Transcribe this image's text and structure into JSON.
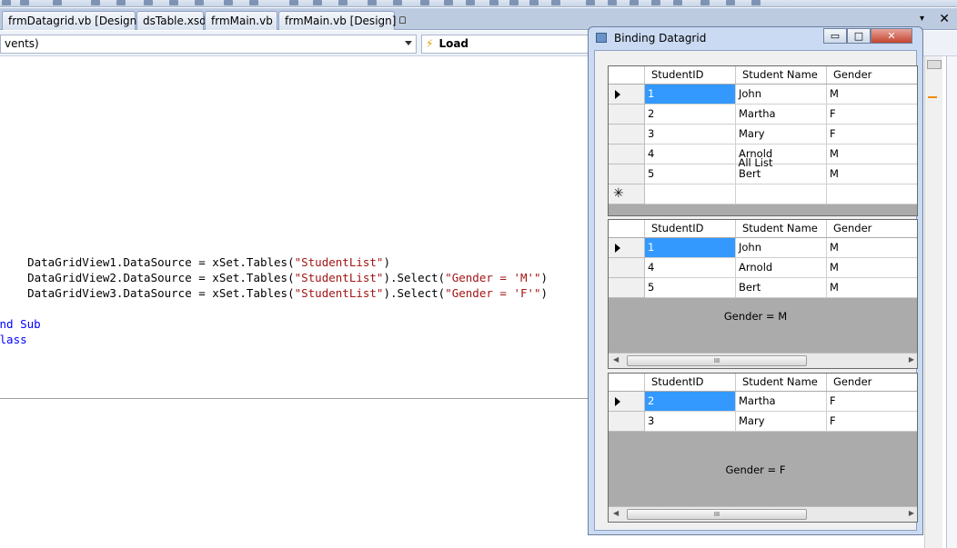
{
  "tabs": [
    {
      "label": "frmDatagrid.vb [Design]",
      "locked": true
    },
    {
      "label": "dsTable.xsd",
      "locked": false
    },
    {
      "label": "frmMain.vb",
      "locked": false
    },
    {
      "label": "frmMain.vb [Design]",
      "locked": true
    }
  ],
  "tab_controls": {
    "dropdown": "▾",
    "close": "✕"
  },
  "combos": {
    "left": "vents)",
    "right": "Load"
  },
  "code_lines": [
    {
      "parts": [
        {
          "t": "    DataGridView1.DataSource = xSet.Tables(",
          "c": ""
        },
        {
          "t": "\"StudentList\"",
          "c": "str"
        },
        {
          "t": ")",
          "c": ""
        }
      ]
    },
    {
      "parts": [
        {
          "t": "    DataGridView2.DataSource = xSet.Tables(",
          "c": ""
        },
        {
          "t": "\"StudentList\"",
          "c": "str"
        },
        {
          "t": ").Select(",
          "c": ""
        },
        {
          "t": "\"Gender = 'M'\"",
          "c": "str"
        },
        {
          "t": ")",
          "c": ""
        }
      ]
    },
    {
      "parts": [
        {
          "t": "    DataGridView3.DataSource = xSet.Tables(",
          "c": ""
        },
        {
          "t": "\"StudentList\"",
          "c": "str"
        },
        {
          "t": ").Select(",
          "c": ""
        },
        {
          "t": "\"Gender = 'F'\"",
          "c": "str"
        },
        {
          "t": ")",
          "c": ""
        }
      ]
    },
    {
      "parts": []
    },
    {
      "parts": [
        {
          "t": "End Sub",
          "c": "kw"
        }
      ]
    },
    {
      "parts": [
        {
          "t": "Class",
          "c": "kw"
        }
      ]
    }
  ],
  "form": {
    "title": "Binding Datagrid",
    "minimize": "▭",
    "maximize": "□",
    "close": "✕"
  },
  "grids": [
    {
      "columns": [
        "StudentID",
        "Student Name",
        "Gender"
      ],
      "rows": [
        [
          "1",
          "John",
          "M"
        ],
        [
          "2",
          "Martha",
          "F"
        ],
        [
          "3",
          "Mary",
          "F"
        ],
        [
          "4",
          "Arnold",
          "M"
        ],
        [
          "5",
          "Bert",
          "M"
        ]
      ],
      "new_row": true,
      "scrollbar": false,
      "label": "All List",
      "scroll_thumb": "III"
    },
    {
      "columns": [
        "StudentID",
        "Student Name",
        "Gender"
      ],
      "rows": [
        [
          "1",
          "John",
          "M"
        ],
        [
          "4",
          "Arnold",
          "M"
        ],
        [
          "5",
          "Bert",
          "M"
        ]
      ],
      "new_row": false,
      "scrollbar": true,
      "label": "Gender = M",
      "scroll_thumb": "III"
    },
    {
      "columns": [
        "StudentID",
        "Student Name",
        "Gender"
      ],
      "rows": [
        [
          "2",
          "Martha",
          "F"
        ],
        [
          "3",
          "Mary",
          "F"
        ]
      ],
      "new_row": false,
      "scrollbar": true,
      "label": "Gender = F",
      "scroll_thumb": "III"
    }
  ],
  "colors": {
    "selection": "#3399ff",
    "tab_bg": "#bccbe0",
    "form_frame": "#c9daf2"
  }
}
